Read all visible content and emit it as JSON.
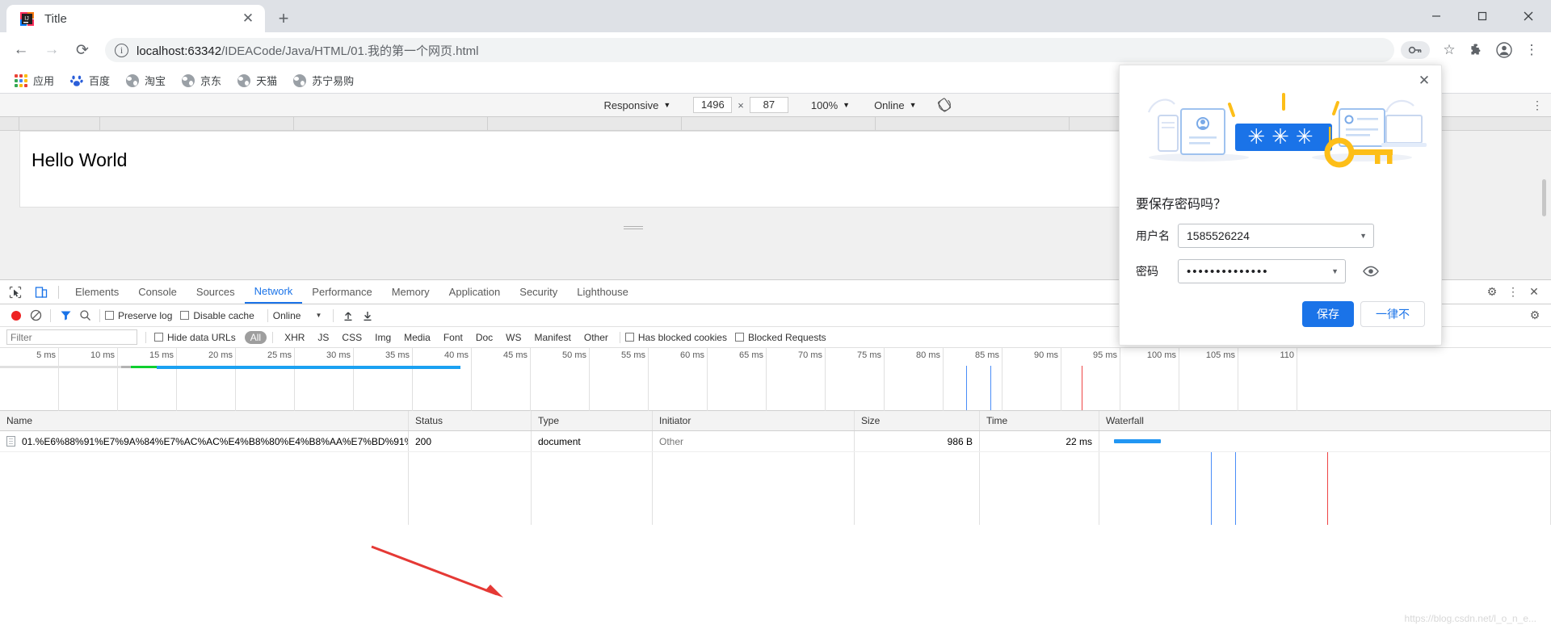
{
  "window": {
    "controls": {
      "minimize": "—",
      "maximize": "☐",
      "close": "✕"
    }
  },
  "tabstrip": {
    "tab_title": "Title",
    "tab_close": "✕",
    "new_tab": "+"
  },
  "toolbar": {
    "back": "←",
    "forward": "→",
    "reload": "⟳",
    "url_host": "localhost:63342",
    "url_path": "/IDEACode/Java/HTML/01.我的第一个网页.html",
    "url_full": "localhost:63342/IDEACode/Java/HTML/01.我的第一个网页.html",
    "info_glyph": "i",
    "star": "☆",
    "extensions": "🧩",
    "profile": "👤",
    "menu": "⋮"
  },
  "bookmarks": [
    {
      "label": "应用",
      "icon": "apps-grid-icon"
    },
    {
      "label": "百度",
      "icon": "baidu-icon"
    },
    {
      "label": "淘宝",
      "icon": "globe-icon"
    },
    {
      "label": "京东",
      "icon": "globe-icon"
    },
    {
      "label": "天猫",
      "icon": "globe-icon"
    },
    {
      "label": "苏宁易购",
      "icon": "globe-icon"
    }
  ],
  "device_toolbar": {
    "device": "Responsive",
    "width": "1496",
    "height": "87",
    "times": "×",
    "zoom": "100%",
    "throttling": "Online",
    "caret": "▼",
    "more": "⋮"
  },
  "viewport": {
    "page_heading": "Hello World"
  },
  "devtools": {
    "tabs": [
      {
        "label": "Elements",
        "active": false
      },
      {
        "label": "Console",
        "active": false
      },
      {
        "label": "Sources",
        "active": false
      },
      {
        "label": "Network",
        "active": true
      },
      {
        "label": "Performance",
        "active": false
      },
      {
        "label": "Memory",
        "active": false
      },
      {
        "label": "Application",
        "active": false
      },
      {
        "label": "Security",
        "active": false
      },
      {
        "label": "Lighthouse",
        "active": false
      }
    ],
    "right_icons": [
      {
        "name": "settings-gear-icon",
        "glyph": "⚙"
      },
      {
        "name": "more-options-icon",
        "glyph": "⋮"
      },
      {
        "name": "close-devtools-icon",
        "glyph": "✕"
      }
    ],
    "network_toolbar": {
      "record": "record-button",
      "clear": "⊘",
      "filter": "filter-icon",
      "search": "⚲",
      "preserve_log": "Preserve log",
      "disable_cache": "Disable cache",
      "throttling": "Online",
      "import": "↑",
      "export": "↓",
      "settings": "⚙"
    },
    "filter_bar": {
      "placeholder": "Filter",
      "value": "",
      "hide_data_urls": "Hide data URLs",
      "types": [
        "All",
        "XHR",
        "JS",
        "CSS",
        "Img",
        "Media",
        "Font",
        "Doc",
        "WS",
        "Manifest",
        "Other"
      ],
      "active_type": "All",
      "has_blocked_cookies": "Has blocked cookies",
      "blocked_requests": "Blocked Requests"
    },
    "timeline": {
      "ticks": [
        "5 ms",
        "10 ms",
        "15 ms",
        "20 ms",
        "25 ms",
        "30 ms",
        "35 ms",
        "40 ms",
        "45 ms",
        "50 ms",
        "55 ms",
        "60 ms",
        "65 ms",
        "70 ms",
        "75 ms",
        "80 ms",
        "85 ms",
        "90 ms",
        "95 ms",
        "100 ms",
        "105 ms",
        "110"
      ]
    },
    "table": {
      "columns": [
        "Name",
        "Status",
        "Type",
        "Initiator",
        "Size",
        "Time",
        "Waterfall"
      ],
      "rows": [
        {
          "name": "01.%E6%88%91%E7%9A%84%E7%AC%AC%E4%B8%80%E4%B8%AA%E7%BD%91%E9…",
          "status": "200",
          "type": "document",
          "initiator": "Other",
          "size": "986 B",
          "time": "22 ms",
          "waterfall": ""
        }
      ]
    },
    "watermark": "https://blog.csdn.net/l_o_n_e..."
  },
  "password_dialog": {
    "close": "✕",
    "title": "要保存密码吗？",
    "username_label": "用户名",
    "username_value": "1585526224",
    "password_label": "密码",
    "password_value": "••••••••••••••",
    "dropdown_caret": "▼",
    "reveal_icon": "eye-icon",
    "save_button": "保存",
    "never_button": "一律不",
    "illustration_chars": "✱ ✱ ✱",
    "accent_color": "#1a73e8"
  }
}
